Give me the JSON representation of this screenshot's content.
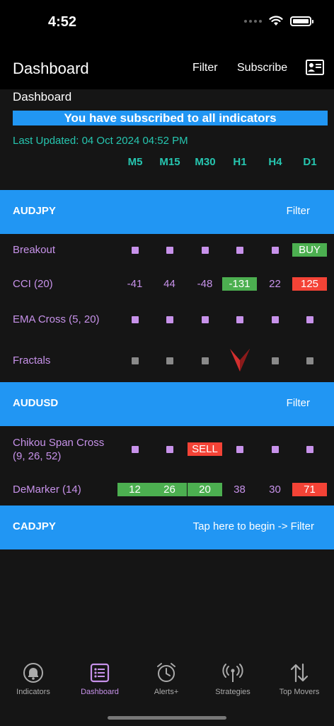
{
  "status": {
    "time": "4:52"
  },
  "nav": {
    "title": "Dashboard",
    "filter": "Filter",
    "subscribe": "Subscribe"
  },
  "section_title": "Dashboard",
  "banner": "You have subscribed to all indicators",
  "last_updated": "Last Updated: 04 Oct 2024 04:52 PM",
  "timeframes": [
    "M5",
    "M15",
    "M30",
    "H1",
    "H4",
    "D1"
  ],
  "groups": [
    {
      "pair": "AUDJPY",
      "filter": "Filter",
      "rows": [
        {
          "label": "Breakout",
          "cells": [
            "",
            "",
            "",
            "",
            "",
            "BUY"
          ]
        },
        {
          "label": "CCI (20)",
          "cells": [
            "-41",
            "44",
            "-48",
            "-131",
            "22",
            "125"
          ]
        },
        {
          "label": "EMA Cross (5, 20)",
          "cells": [
            "",
            "",
            "",
            "",
            "",
            ""
          ]
        },
        {
          "label": "Fractals",
          "cells": [
            "",
            "",
            "",
            "",
            "",
            ""
          ]
        }
      ]
    },
    {
      "pair": "AUDUSD",
      "filter": "Filter",
      "rows": [
        {
          "label": "Chikou Span Cross (9, 26, 52)",
          "cells": [
            "",
            "",
            "SELL",
            "",
            "",
            ""
          ]
        },
        {
          "label": "DeMarker (14)",
          "cells": [
            "12",
            "26",
            "20",
            "38",
            "30",
            "71"
          ]
        }
      ]
    },
    {
      "pair": "CADJPY",
      "filter": "Tap here to begin -> Filter",
      "rows": []
    }
  ],
  "tabs": [
    {
      "label": "Indicators",
      "icon": "bell-icon"
    },
    {
      "label": "Dashboard",
      "icon": "list-icon",
      "active": true
    },
    {
      "label": "Alerts+",
      "icon": "alarm-clock-icon"
    },
    {
      "label": "Strategies",
      "icon": "broadcast-icon"
    },
    {
      "label": "Top Movers",
      "icon": "arrows-up-down-icon"
    }
  ],
  "colors": {
    "accent": "#2196F3",
    "teal": "#26c6b0",
    "purple": "#c792ea",
    "buy": "#4caf50",
    "sell": "#f44336"
  }
}
